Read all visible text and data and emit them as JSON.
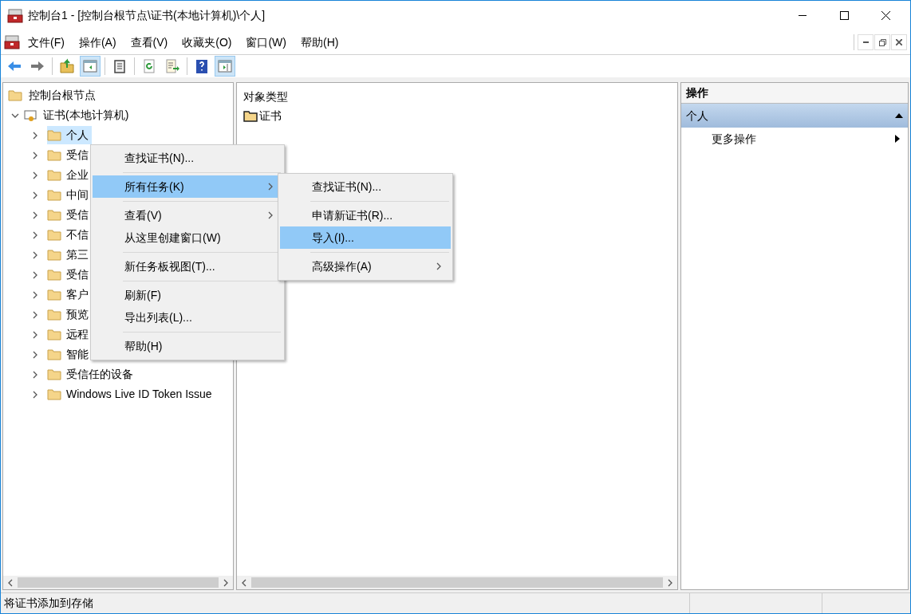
{
  "window": {
    "title": "控制台1 - [控制台根节点\\证书(本地计算机)\\个人]"
  },
  "menu_bar": [
    "文件(F)",
    "操作(A)",
    "查看(V)",
    "收藏夹(O)",
    "窗口(W)",
    "帮助(H)"
  ],
  "toolbar": [
    {
      "kind": "back",
      "selected": false
    },
    {
      "kind": "forward",
      "selected": false
    },
    {
      "kind": "separator"
    },
    {
      "kind": "up",
      "selected": false
    },
    {
      "kind": "tree",
      "selected": true
    },
    {
      "kind": "separator"
    },
    {
      "kind": "clipboard",
      "selected": false
    },
    {
      "kind": "separator"
    },
    {
      "kind": "refresh",
      "selected": false
    },
    {
      "kind": "export",
      "selected": false
    },
    {
      "kind": "separator"
    },
    {
      "kind": "help",
      "selected": false
    },
    {
      "kind": "pane",
      "selected": true
    }
  ],
  "tree": {
    "label": "控制台根节点",
    "children": [
      {
        "label": "证书(本地计算机)",
        "expanded": true,
        "children": [
          {
            "label": "个人",
            "selected": true
          },
          {
            "label": "受信",
            "selected": false
          },
          {
            "label": "企业",
            "selected": false
          },
          {
            "label": "中间",
            "selected": false
          },
          {
            "label": "受信",
            "selected": false
          },
          {
            "label": "不信",
            "selected": false
          },
          {
            "label": "第三",
            "selected": false
          },
          {
            "label": "受信",
            "selected": false
          },
          {
            "label": "客户",
            "selected": false
          },
          {
            "label": "预览",
            "selected": false
          },
          {
            "label": "远程",
            "selected": false
          },
          {
            "label": "智能",
            "selected": false
          },
          {
            "label": "受信任的设备",
            "selected": false
          },
          {
            "label": "Windows Live ID Token Issue",
            "selected": false
          }
        ]
      }
    ]
  },
  "list": {
    "column": "对象类型",
    "items": [
      "证书"
    ]
  },
  "actions": {
    "title": "操作",
    "section": "个人",
    "expanded": true,
    "items": [
      "更多操作"
    ]
  },
  "context_menu": [
    {
      "kind": "item",
      "label": "查找证书(N)...",
      "submenu": false,
      "selected": false
    },
    {
      "kind": "separator"
    },
    {
      "kind": "item",
      "label": "所有任务(K)",
      "submenu": true,
      "selected": true
    },
    {
      "kind": "separator"
    },
    {
      "kind": "item",
      "label": "查看(V)",
      "submenu": true,
      "selected": false
    },
    {
      "kind": "item",
      "label": "从这里创建窗口(W)",
      "submenu": false,
      "selected": false
    },
    {
      "kind": "separator"
    },
    {
      "kind": "item",
      "label": "新任务板视图(T)...",
      "submenu": false,
      "selected": false
    },
    {
      "kind": "separator"
    },
    {
      "kind": "item",
      "label": "刷新(F)",
      "submenu": false,
      "selected": false
    },
    {
      "kind": "item",
      "label": "导出列表(L)...",
      "submenu": false,
      "selected": false
    },
    {
      "kind": "separator"
    },
    {
      "kind": "item",
      "label": "帮助(H)",
      "submenu": false,
      "selected": false
    }
  ],
  "submenu": [
    {
      "kind": "item",
      "label": "查找证书(N)...",
      "submenu": false,
      "selected": false
    },
    {
      "kind": "separator"
    },
    {
      "kind": "item",
      "label": "申请新证书(R)...",
      "submenu": false,
      "selected": false
    },
    {
      "kind": "item",
      "label": "导入(I)...",
      "submenu": false,
      "selected": true
    },
    {
      "kind": "separator"
    },
    {
      "kind": "item",
      "label": "高级操作(A)",
      "submenu": true,
      "selected": false
    }
  ],
  "status_bar": "将证书添加到存储"
}
